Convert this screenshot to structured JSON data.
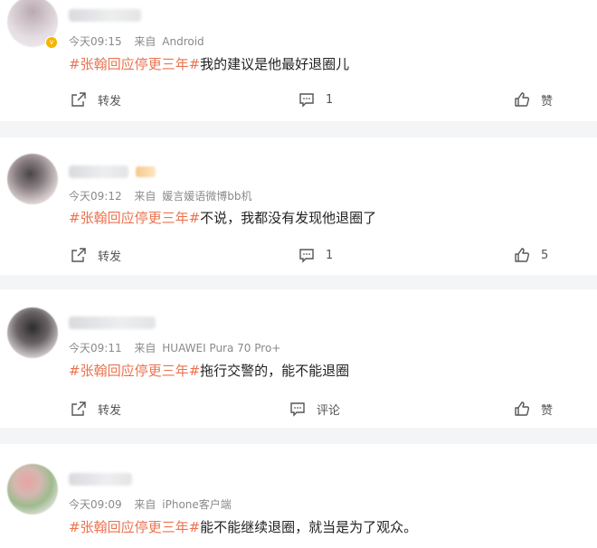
{
  "labels": {
    "source_prefix": "来自",
    "repost": "转发",
    "comment": "评论",
    "like": "赞"
  },
  "posts": [
    {
      "time": "今天09:15",
      "source": "Android",
      "hashtag": "#张翰回应停更三年#",
      "text": "我的建议是他最好退圈儿",
      "comment_count": "1",
      "like_count": ""
    },
    {
      "time": "今天09:12",
      "source": "媛言媛语微博bb机",
      "hashtag": "#张翰回应停更三年#",
      "text": "不说，我都没有发现他退圈了",
      "comment_count": "1",
      "like_count": "5"
    },
    {
      "time": "今天09:11",
      "source": "HUAWEI Pura 70 Pro+",
      "hashtag": "#张翰回应停更三年#",
      "text": "拖行交警的，能不能退圈",
      "comment_count": "",
      "like_count": ""
    },
    {
      "time": "今天09:09",
      "source": "iPhone客户端",
      "hashtag": "#张翰回应停更三年#",
      "text": "能不能继续退圈，就当是为了观众。"
    }
  ],
  "colors": {
    "hashtag": "#eb7350",
    "verified_badge": "#f5b400"
  },
  "icons": {
    "repost": "share-arrow-icon",
    "comment": "comment-bubble-icon",
    "like": "thumbs-up-icon"
  }
}
